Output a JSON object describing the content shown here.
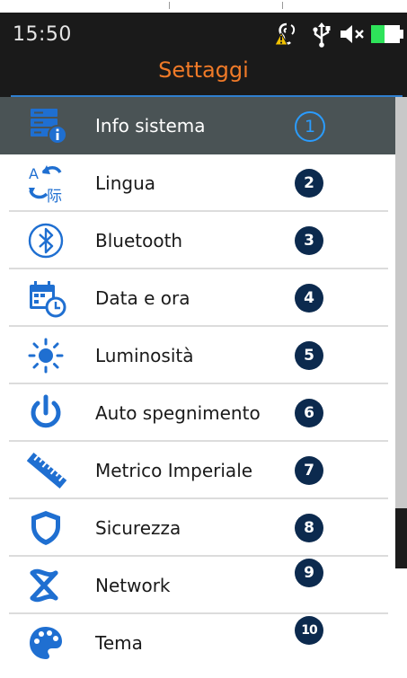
{
  "status_bar": {
    "time": "15:50",
    "icons": [
      "hearing-warning-icon",
      "usb-icon",
      "mute-icon",
      "battery-icon"
    ],
    "battery_color": "#2ee35a",
    "warning_color": "#f2c200"
  },
  "header": {
    "title": "Settaggi",
    "title_color": "#f07a28",
    "divider_color": "#2f7fd0"
  },
  "menu": {
    "selected_index": 0,
    "icon_color": "#1f6fd1",
    "items": [
      {
        "label": "Info sistema",
        "number": "1",
        "icon": "system-info-icon"
      },
      {
        "label": "Lingua",
        "number": "2",
        "icon": "language-icon"
      },
      {
        "label": "Bluetooth",
        "number": "3",
        "icon": "bluetooth-icon"
      },
      {
        "label": "Data e ora",
        "number": "4",
        "icon": "calendar-clock-icon"
      },
      {
        "label": "Luminosità",
        "number": "5",
        "icon": "brightness-icon"
      },
      {
        "label": "Auto spegnimento",
        "number": "6",
        "icon": "power-icon"
      },
      {
        "label": "Metrico Imperiale",
        "number": "7",
        "icon": "ruler-icon"
      },
      {
        "label": "Sicurezza",
        "number": "8",
        "icon": "shield-icon"
      },
      {
        "label": "Network",
        "number": "9",
        "icon": "network-icon"
      },
      {
        "label": "Tema",
        "number": "10",
        "icon": "palette-icon"
      }
    ]
  }
}
